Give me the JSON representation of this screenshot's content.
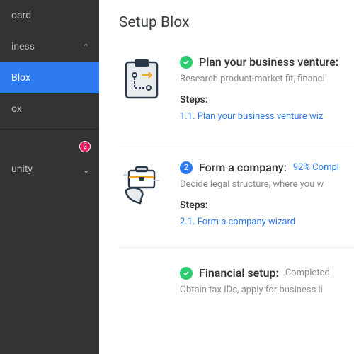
{
  "sidebar": {
    "items": [
      {
        "label": "oard"
      },
      {
        "label": "iness",
        "expand": true
      },
      {
        "label": "Blox",
        "active": true
      },
      {
        "label": "ox"
      },
      {
        "label": "",
        "badge": "2"
      },
      {
        "label": "unity",
        "expand": false
      }
    ]
  },
  "page": {
    "title": "Setup Blox"
  },
  "steps": [
    {
      "icon": "plan",
      "complete": true,
      "title": "Plan your business venture:",
      "status": "",
      "desc": "Research product-market fit, financi",
      "steps_label": "Steps:",
      "link": "1.1. Plan your business venture wiz"
    },
    {
      "icon": "briefcase",
      "num": "2",
      "title": "Form a company:",
      "status": "92% Compl",
      "status_blue": true,
      "desc": "Decide legal structure, where you w",
      "steps_label": "Steps:",
      "link": "2.1. Form a company wizard"
    },
    {
      "icon": "none",
      "complete": true,
      "title": "Financial setup:",
      "status": "Completed",
      "desc": "Obtain tax IDs, apply for business li"
    }
  ]
}
